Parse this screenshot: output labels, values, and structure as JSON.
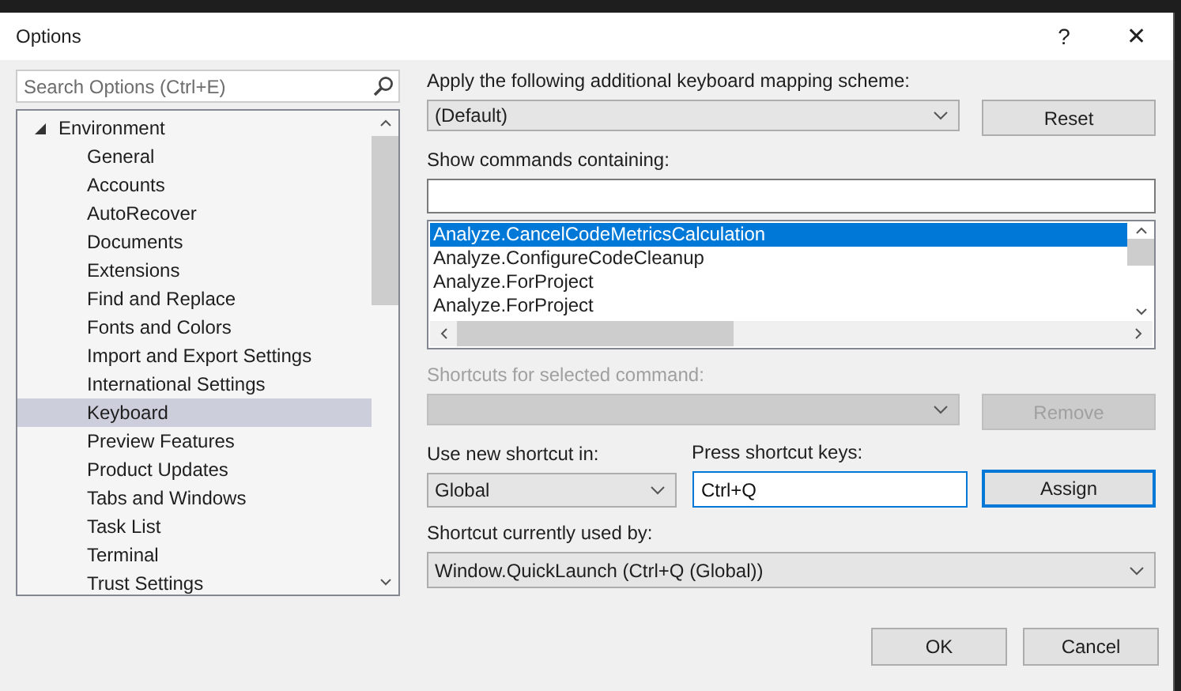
{
  "window": {
    "title": "Options",
    "help_glyph": "?",
    "close_glyph": "✕"
  },
  "search": {
    "placeholder": "Search Options (Ctrl+E)"
  },
  "tree": [
    {
      "label": "Environment",
      "expanded": true,
      "selected": false,
      "children": [
        {
          "label": "General",
          "selected": false
        },
        {
          "label": "Accounts",
          "selected": false
        },
        {
          "label": "AutoRecover",
          "selected": false
        },
        {
          "label": "Documents",
          "selected": false
        },
        {
          "label": "Extensions",
          "selected": false
        },
        {
          "label": "Find and Replace",
          "selected": false
        },
        {
          "label": "Fonts and Colors",
          "selected": false
        },
        {
          "label": "Import and Export Settings",
          "selected": false
        },
        {
          "label": "International Settings",
          "selected": false
        },
        {
          "label": "Keyboard",
          "selected": true
        },
        {
          "label": "Preview Features",
          "selected": false
        },
        {
          "label": "Product Updates",
          "selected": false
        },
        {
          "label": "Tabs and Windows",
          "selected": false
        },
        {
          "label": "Task List",
          "selected": false
        },
        {
          "label": "Terminal",
          "selected": false
        },
        {
          "label": "Trust Settings",
          "selected": false
        }
      ]
    }
  ],
  "mapping": {
    "label": "Apply the following additional keyboard mapping scheme:",
    "value": "(Default)",
    "button": "Reset"
  },
  "commands": {
    "label": "Show commands containing:",
    "items": [
      {
        "label": "Analyze.CancelCodeMetricsCalculation",
        "selected": true
      },
      {
        "label": "Analyze.ConfigureCodeCleanup",
        "selected": false
      },
      {
        "label": "Analyze.ForProject",
        "selected": false
      },
      {
        "label": "Analyze.ForProject",
        "selected": false
      }
    ]
  },
  "shortcuts": {
    "label": "Shortcuts for selected command:",
    "disabled": true,
    "button": "Remove"
  },
  "scope": {
    "label": "Use new shortcut in:",
    "value": "Global"
  },
  "keys": {
    "label": "Press shortcut keys:",
    "value": "Ctrl+Q"
  },
  "assign": {
    "label": "Assign",
    "default": true
  },
  "used_by": {
    "label": "Shortcut currently used by:",
    "value": "Window.QuickLaunch (Ctrl+Q (Global))"
  },
  "buttons": [
    "OK",
    "Cancel"
  ]
}
